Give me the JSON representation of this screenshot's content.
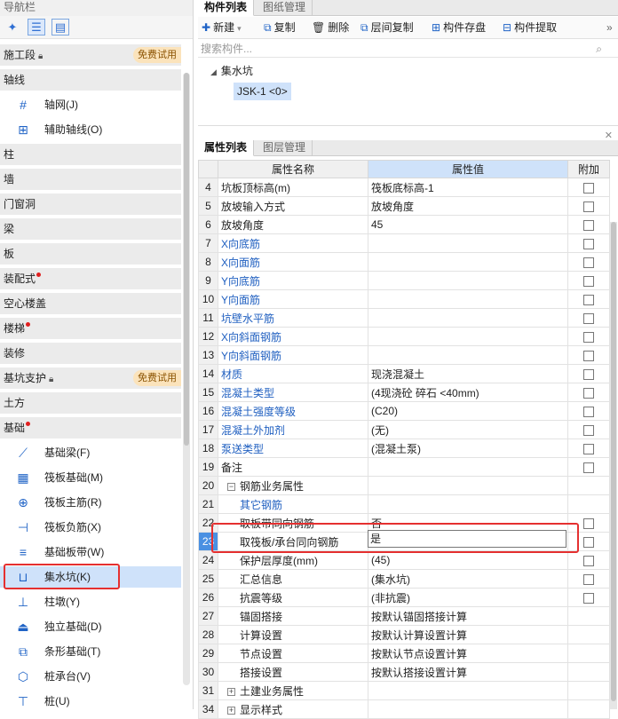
{
  "nav": {
    "title": "导航栏",
    "categories": {
      "construction": "施工段",
      "axis": "轴线",
      "column": "柱",
      "wall": "墙",
      "door": "门窗洞",
      "beam": "梁",
      "slab": "板",
      "prefab": "装配式",
      "hollow": "空心楼盖",
      "stair": "楼梯",
      "decor": "装修",
      "pit_support": "基坑支护",
      "earth": "土方",
      "foundation": "基础"
    },
    "badge": "免费试用",
    "axis_items": [
      "轴网(J)",
      "辅助轴线(O)"
    ],
    "foundation_items": [
      "基础梁(F)",
      "筏板基础(M)",
      "筏板主筋(R)",
      "筏板负筋(X)",
      "基础板带(W)",
      "集水坑(K)",
      "柱墩(Y)",
      "独立基础(D)",
      "条形基础(T)",
      "桩承台(V)",
      "桩(U)"
    ]
  },
  "component_panel": {
    "tabs": [
      "构件列表",
      "图纸管理"
    ],
    "toolbar": [
      "新建",
      "复制",
      "删除",
      "层间复制",
      "构件存盘",
      "构件提取"
    ],
    "search_placeholder": "搜索构件...",
    "tree_root": "集水坑",
    "tree_leaf": "JSK-1 <0>"
  },
  "property_panel": {
    "tabs": [
      "属性列表",
      "图层管理"
    ],
    "headers": {
      "name": "属性名称",
      "value": "属性值",
      "extra": "附加"
    },
    "rows": [
      {
        "num": "4",
        "name": "坑板顶标高(m)",
        "value": "筏板底标高-1"
      },
      {
        "num": "5",
        "name": "放坡输入方式",
        "value": "放坡角度"
      },
      {
        "num": "6",
        "name": "放坡角度",
        "value": "45"
      },
      {
        "num": "7",
        "name": "X向底筋",
        "value": ""
      },
      {
        "num": "8",
        "name": "X向面筋",
        "value": ""
      },
      {
        "num": "9",
        "name": "Y向底筋",
        "value": ""
      },
      {
        "num": "10",
        "name": "Y向面筋",
        "value": ""
      },
      {
        "num": "11",
        "name": "坑壁水平筋",
        "value": ""
      },
      {
        "num": "12",
        "name": "X向斜面钢筋",
        "value": ""
      },
      {
        "num": "13",
        "name": "Y向斜面钢筋",
        "value": ""
      },
      {
        "num": "14",
        "name": "材质",
        "value": "现浇混凝土"
      },
      {
        "num": "15",
        "name": "混凝土类型",
        "value": "(4现浇砼 碎石 <40mm)"
      },
      {
        "num": "16",
        "name": "混凝土强度等级",
        "value": "(C20)"
      },
      {
        "num": "17",
        "name": "混凝土外加剂",
        "value": "(无)"
      },
      {
        "num": "18",
        "name": "泵送类型",
        "value": "(混凝土泵)"
      },
      {
        "num": "19",
        "name": "备注",
        "value": ""
      },
      {
        "num": "20",
        "name": "钢筋业务属性",
        "value": ""
      },
      {
        "num": "21",
        "name": "其它钢筋",
        "value": ""
      },
      {
        "num": "22",
        "name": "取板带同向钢筋",
        "value": "否"
      },
      {
        "num": "23",
        "name": "取筏板/承台同向钢筋",
        "value": "是"
      },
      {
        "num": "24",
        "name": "保护层厚度(mm)",
        "value": "(45)"
      },
      {
        "num": "25",
        "name": "汇总信息",
        "value": "(集水坑)"
      },
      {
        "num": "26",
        "name": "抗震等级",
        "value": "(非抗震)"
      },
      {
        "num": "27",
        "name": "锚固搭接",
        "value": "按默认锚固搭接计算"
      },
      {
        "num": "28",
        "name": "计算设置",
        "value": "按默认计算设置计算"
      },
      {
        "num": "29",
        "name": "节点设置",
        "value": "按默认节点设置计算"
      },
      {
        "num": "30",
        "name": "搭接设置",
        "value": "按默认搭接设置计算"
      },
      {
        "num": "31",
        "name": "土建业务属性",
        "value": ""
      },
      {
        "num": "34",
        "name": "显示样式",
        "value": ""
      }
    ]
  },
  "colors": {
    "accent": "#1f63c6",
    "selection": "#cfe2fa",
    "highlight_box": "#e53030"
  }
}
